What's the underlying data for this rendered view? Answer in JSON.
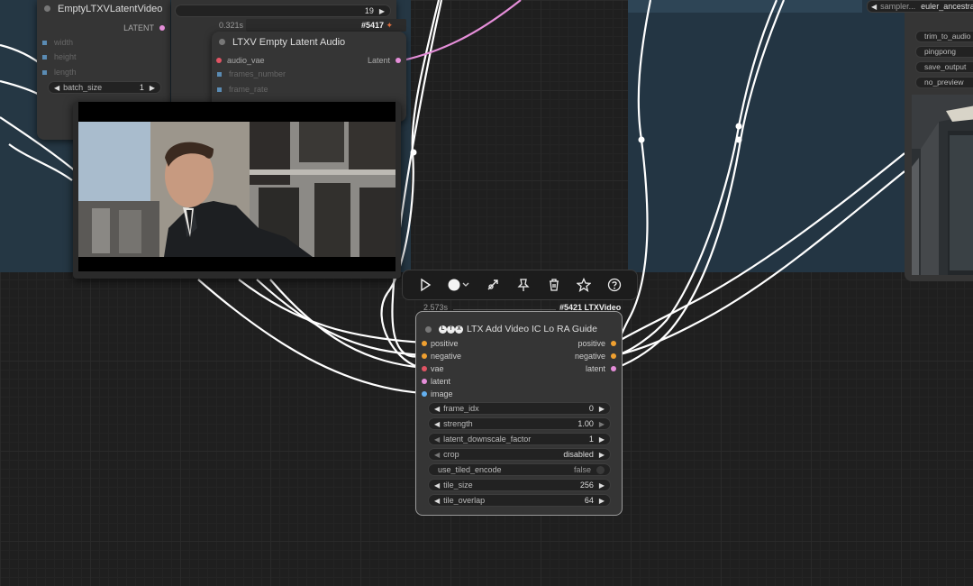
{
  "colors": {
    "canvas": "#1f1f1f",
    "group": "#253744",
    "node": "#353535",
    "wire": "#ffffff",
    "wire_pink": "#e58ed9",
    "slot_orange": "#f0a030",
    "slot_red": "#e05464",
    "slot_pink": "#e58ed9",
    "slot_blue": "#64b0f0"
  },
  "empty_latent_node": {
    "title": "EmptyLTXVLatentVideo",
    "output": "LATENT",
    "inputs": [
      "width",
      "height",
      "length"
    ],
    "batch_label": "batch_size",
    "batch_value": "1"
  },
  "mid_node": {
    "value": "19",
    "timing": "0.321s",
    "badge": "#5417"
  },
  "audio_node": {
    "title": "LTXV Empty Latent Audio",
    "input": "audio_vae",
    "output": "Latent",
    "inputs": [
      "frames_number",
      "frame_rate"
    ]
  },
  "toolbar": {
    "icons": [
      "play-icon",
      "color-dot-icon",
      "bypass-icon",
      "pin-icon",
      "trash-icon",
      "star-icon",
      "help-icon"
    ]
  },
  "main_node": {
    "timing": "2.573s",
    "badge": "#5421 LTXVideo",
    "title": "LTX Add Video IC Lo RA Guide",
    "inputs": [
      "positive",
      "negative",
      "vae",
      "latent",
      "image"
    ],
    "outputs": [
      "positive",
      "negative",
      "latent"
    ],
    "widgets": [
      {
        "label": "frame_idx",
        "value": "0"
      },
      {
        "label": "strength",
        "value": "1.00"
      },
      {
        "label": "latent_downscale_factor",
        "value": "1"
      },
      {
        "label": "crop",
        "value": "disabled"
      },
      {
        "label": "use_tiled_encode",
        "value": "false"
      },
      {
        "label": "tile_size",
        "value": "256"
      },
      {
        "label": "tile_overlap",
        "value": "64"
      }
    ]
  },
  "right_node": {
    "sampler_label": "sampler...",
    "sampler_value": "euler_ancestral",
    "pills": [
      "trim_to_audio",
      "pingpong",
      "save_output",
      "no_preview"
    ]
  }
}
